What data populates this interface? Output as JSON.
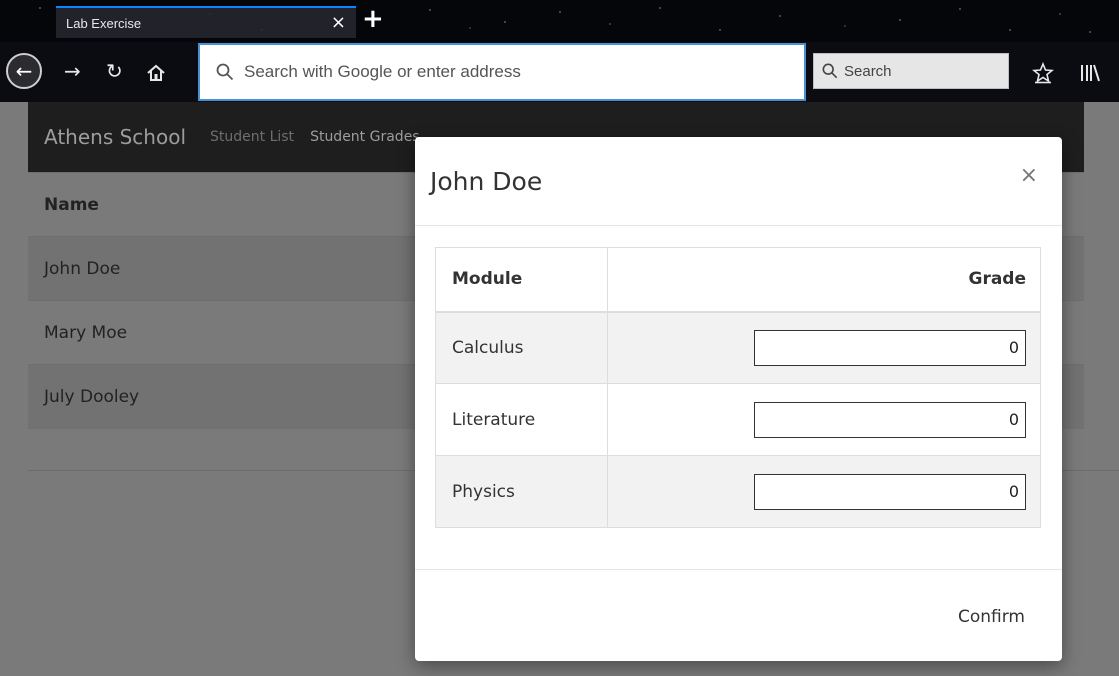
{
  "browser": {
    "tab_title": "Lab Exercise",
    "tab_close": "×",
    "new_tab": "+",
    "url_placeholder": "Search with Google or enter address",
    "search_placeholder": "Search"
  },
  "app": {
    "brand": "Athens School",
    "nav": [
      {
        "label": "Student List"
      },
      {
        "label": "Student Grades"
      }
    ],
    "table": {
      "headers": [
        "Name"
      ],
      "rows": [
        {
          "name": "John Doe"
        },
        {
          "name": "Mary Moe"
        },
        {
          "name": "July Dooley"
        }
      ]
    }
  },
  "modal": {
    "title": "John Doe",
    "close": "×",
    "headers": {
      "module": "Module",
      "grade": "Grade"
    },
    "rows": [
      {
        "module": "Calculus",
        "grade": "0"
      },
      {
        "module": "Literature",
        "grade": "0"
      },
      {
        "module": "Physics",
        "grade": "0"
      }
    ],
    "confirm_label": "Confirm"
  },
  "colors": {
    "accent": "#0a84ff",
    "url_focus": "#4a90d9",
    "overlay": "#7a7a7a"
  }
}
